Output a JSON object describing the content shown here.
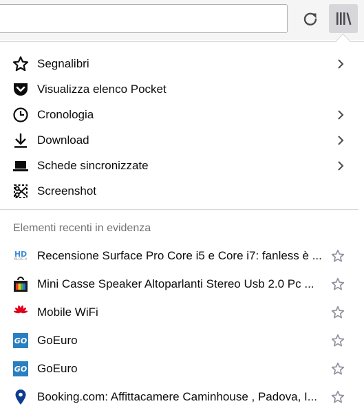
{
  "toolbar": {
    "urlbar_value": "",
    "reload_icon": "reload-icon",
    "library_icon": "library-icon"
  },
  "menu": {
    "items": [
      {
        "label": "Segnalibri",
        "icon": "star-outline-icon",
        "has_submenu": true
      },
      {
        "label": "Visualizza elenco Pocket",
        "icon": "pocket-icon",
        "has_submenu": false
      },
      {
        "label": "Cronologia",
        "icon": "clock-icon",
        "has_submenu": true
      },
      {
        "label": "Download",
        "icon": "download-icon",
        "has_submenu": true
      },
      {
        "label": "Schede sincronizzate",
        "icon": "synced-tabs-icon",
        "has_submenu": true
      },
      {
        "label": "Screenshot",
        "icon": "screenshot-icon",
        "has_submenu": false
      }
    ]
  },
  "recent": {
    "section_title": "Elementi recenti in evidenza",
    "items": [
      {
        "title": "Recensione Surface Pro Core i5 e Core i7: fanless è ...",
        "favicon": "hdblog-favicon"
      },
      {
        "title": "Mini Casse Speaker Altoparlanti Stereo Usb 2.0 Pc ...",
        "favicon": "shop-favicon"
      },
      {
        "title": "Mobile WiFi",
        "favicon": "huawei-favicon"
      },
      {
        "title": "GoEuro",
        "favicon": "goeuro-favicon",
        "logo_text": "GO"
      },
      {
        "title": "GoEuro",
        "favicon": "goeuro-favicon",
        "logo_text": "GO"
      },
      {
        "title": "Booking.com: Affittacamere Caminhouse , Padova, I...",
        "favicon": "location-pin-favicon"
      }
    ]
  },
  "hdblog_logo": {
    "top": "HD",
    "bottom": "BLOG.it"
  },
  "colors": {
    "accent_blue": "#0a84ff",
    "goeuro_blue": "#2a7fc1",
    "huawei_red": "#e1001c",
    "separator": "#d7d7db"
  }
}
